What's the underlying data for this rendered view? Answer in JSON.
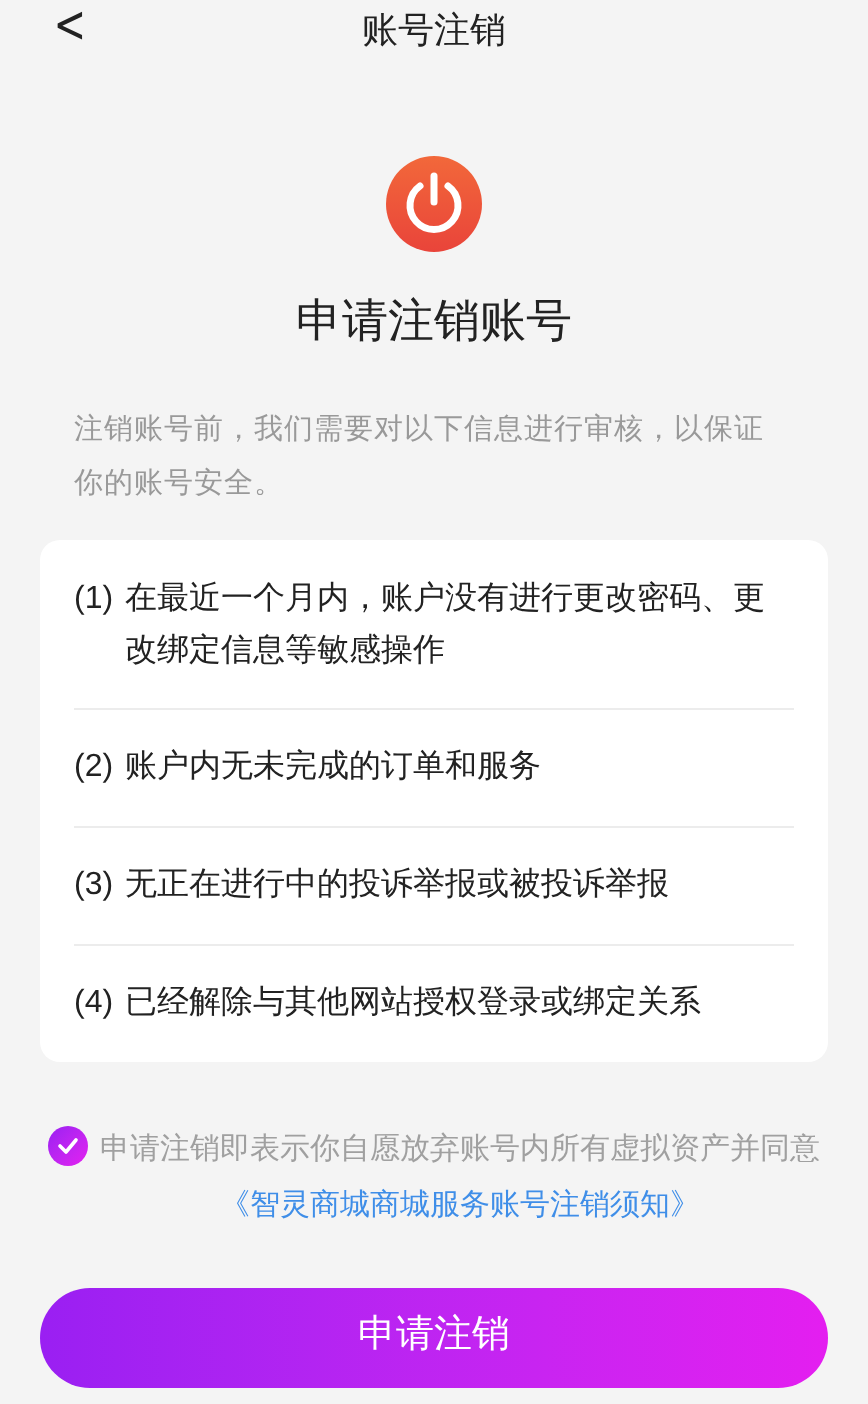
{
  "header": {
    "back": "<",
    "title": "账号注销"
  },
  "heading": "申请注销账号",
  "intro": "注销账号前，我们需要对以下信息进行审核，以保证你的账号安全。",
  "conditions": [
    {
      "number": "(1)",
      "text": "在最近一个月内，账户没有进行更改密码、更改绑定信息等敏感操作"
    },
    {
      "number": "(2)",
      "text": "账户内无未完成的订单和服务"
    },
    {
      "number": "(3)",
      "text": "无正在进行中的投诉举报或被投诉举报"
    },
    {
      "number": "(4)",
      "text": "已经解除与其他网站授权登录或绑定关系"
    }
  ],
  "agreement": {
    "checked": true,
    "text": "申请注销即表示你自愿放弃账号内所有虚拟资产并同意",
    "link": "《智灵商城商城服务账号注销须知》"
  },
  "submit": "申请注销"
}
